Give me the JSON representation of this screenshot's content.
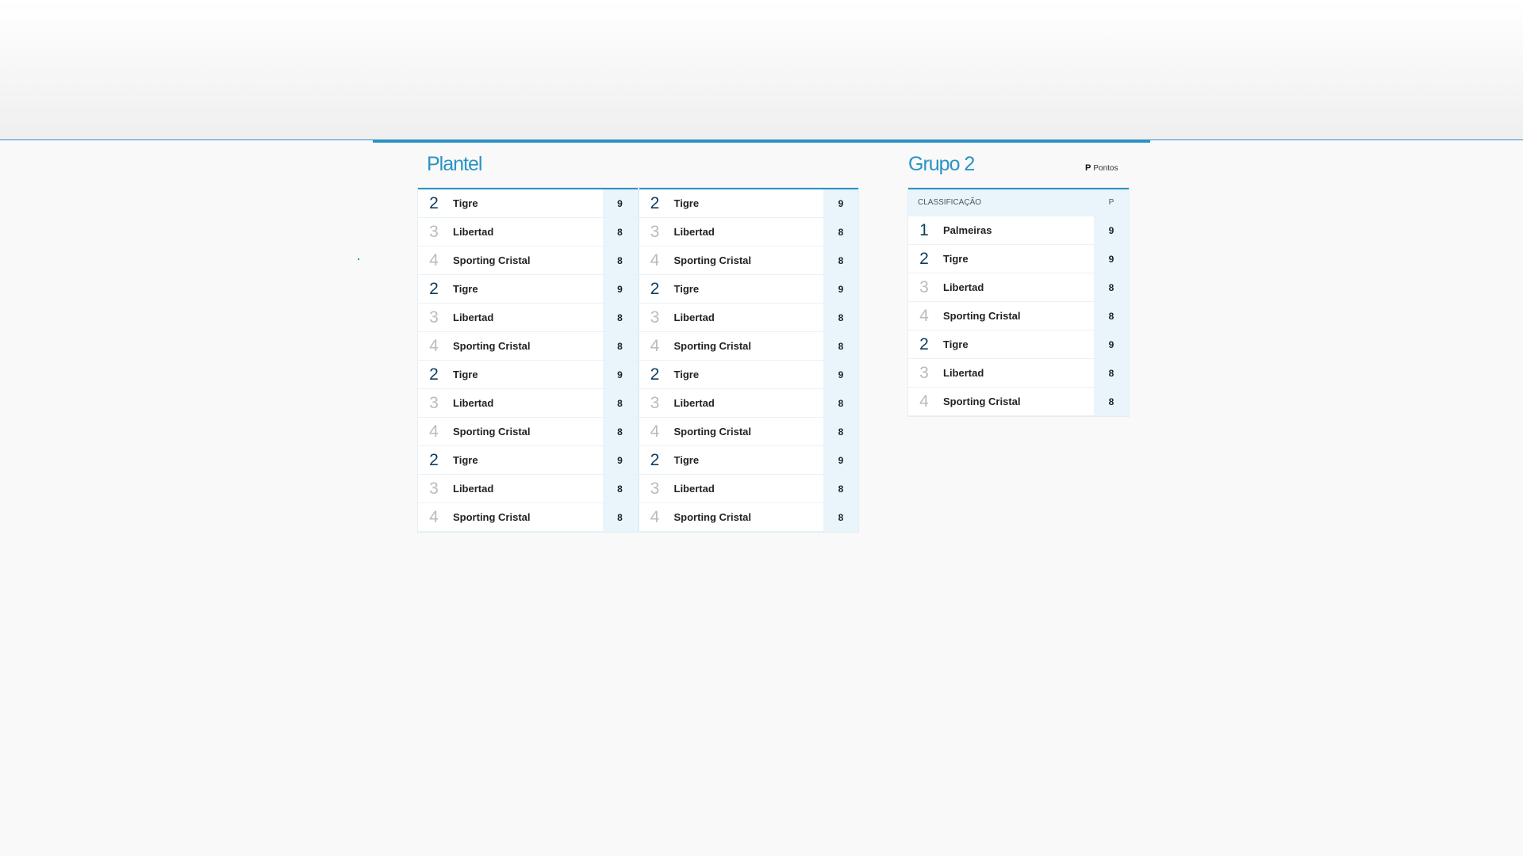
{
  "plantel": {
    "title": "Plantel",
    "rows": [
      {
        "left": {
          "pos": "2",
          "team": "Tigre",
          "pts": "9"
        },
        "right": {
          "pos": "2",
          "team": "Tigre",
          "pts": "9"
        }
      },
      {
        "left": {
          "pos": "3",
          "team": "Libertad",
          "pts": "8"
        },
        "right": {
          "pos": "3",
          "team": "Libertad",
          "pts": "8"
        }
      },
      {
        "left": {
          "pos": "4",
          "team": "Sporting Cristal",
          "pts": "8"
        },
        "right": {
          "pos": "4",
          "team": "Sporting Cristal",
          "pts": "8"
        }
      },
      {
        "left": {
          "pos": "2",
          "team": "Tigre",
          "pts": "9"
        },
        "right": {
          "pos": "2",
          "team": "Tigre",
          "pts": "9"
        }
      },
      {
        "left": {
          "pos": "3",
          "team": "Libertad",
          "pts": "8"
        },
        "right": {
          "pos": "3",
          "team": "Libertad",
          "pts": "8"
        }
      },
      {
        "left": {
          "pos": "4",
          "team": "Sporting Cristal",
          "pts": "8"
        },
        "right": {
          "pos": "4",
          "team": "Sporting Cristal",
          "pts": "8"
        }
      },
      {
        "left": {
          "pos": "2",
          "team": "Tigre",
          "pts": "9"
        },
        "right": {
          "pos": "2",
          "team": "Tigre",
          "pts": "9"
        }
      },
      {
        "left": {
          "pos": "3",
          "team": "Libertad",
          "pts": "8"
        },
        "right": {
          "pos": "3",
          "team": "Libertad",
          "pts": "8"
        }
      },
      {
        "left": {
          "pos": "4",
          "team": "Sporting Cristal",
          "pts": "8"
        },
        "right": {
          "pos": "4",
          "team": "Sporting Cristal",
          "pts": "8"
        }
      },
      {
        "left": {
          "pos": "2",
          "team": "Tigre",
          "pts": "9"
        },
        "right": {
          "pos": "2",
          "team": "Tigre",
          "pts": "9"
        }
      },
      {
        "left": {
          "pos": "3",
          "team": "Libertad",
          "pts": "8"
        },
        "right": {
          "pos": "3",
          "team": "Libertad",
          "pts": "8"
        }
      },
      {
        "left": {
          "pos": "4",
          "team": "Sporting Cristal",
          "pts": "8"
        },
        "right": {
          "pos": "4",
          "team": "Sporting Cristal",
          "pts": "8"
        }
      }
    ]
  },
  "grupo": {
    "title": "Grupo 2",
    "legend_abbr": "P",
    "legend_text": "Pontos",
    "header_col": "CLASSIFICAÇÃO",
    "header_pts": "P",
    "rows": [
      {
        "pos": "1",
        "team": "Palmeiras",
        "pts": "9"
      },
      {
        "pos": "2",
        "team": "Tigre",
        "pts": "9"
      },
      {
        "pos": "3",
        "team": "Libertad",
        "pts": "8"
      },
      {
        "pos": "4",
        "team": "Sporting Cristal",
        "pts": "8"
      },
      {
        "pos": "2",
        "team": "Tigre",
        "pts": "9"
      },
      {
        "pos": "3",
        "team": "Libertad",
        "pts": "8"
      },
      {
        "pos": "4",
        "team": "Sporting Cristal",
        "pts": "8"
      }
    ]
  },
  "colors": {
    "accent": "#2a93c4",
    "strong_position": "#0d3d5e",
    "muted_position": "#bbbbbb",
    "points_bg": "#eaf4fb"
  }
}
